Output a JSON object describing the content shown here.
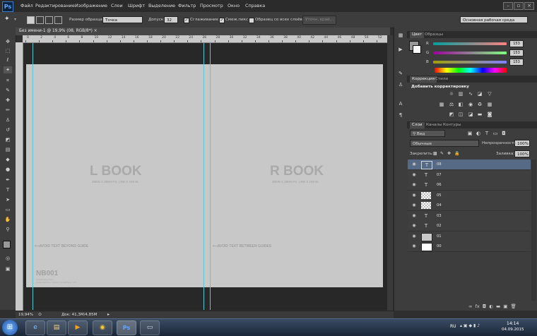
{
  "app": {
    "logo": "Ps"
  },
  "menu": [
    "Файл",
    "Редактирование",
    "Изображение",
    "Слои",
    "Шрифт",
    "Выделение",
    "Фильтр",
    "Просмотр",
    "Окно",
    "Справка"
  ],
  "options_bar": {
    "sample_size_label": "Размер образца:",
    "sample_size_value": "Точка",
    "tolerance_label": "Допуск:",
    "tolerance_value": "32",
    "antialias_label": "Сглаживание",
    "contiguous_label": "Смеж.пикс",
    "sample_all_label": "Образец со всех слоёв",
    "refine_button": "Уточн. край...",
    "workspace_value": "Основная рабочая среда"
  },
  "document": {
    "tab_title": "Без имени-1 @ 19,9% (08, RGB/8*) ×",
    "left_title": "L BOOK",
    "left_sub": "380W X 380H PX. | 8W X 100 M.",
    "right_title": "R BOOK",
    "right_sub": "380W X 380H PX. | 8W X 100 M.",
    "avoid_left": "AVOID TEXT BEYOND GUIDE",
    "avoid_right": "AVOID TEXT BETWEEN GUIDES",
    "code": "NB001",
    "code_lines": [
      "Something here",
      "Some details / Client / Something, Ltd."
    ]
  },
  "ruler_top": [
    "0",
    "2",
    "4",
    "6",
    "8",
    "10",
    "12",
    "14",
    "16",
    "18",
    "20",
    "22",
    "24",
    "26",
    "28",
    "30",
    "32",
    "34",
    "36",
    "38",
    "40",
    "42",
    "44",
    "46",
    "48",
    "50",
    "52"
  ],
  "status": {
    "zoom": "19,94%",
    "doc": "Док: 41,3M/4,85M"
  },
  "color_panel": {
    "tabs": [
      "Цвет",
      "Образцы"
    ],
    "channels": [
      {
        "label": "R",
        "value": "153"
      },
      {
        "label": "G",
        "value": "153"
      },
      {
        "label": "B",
        "value": "153"
      }
    ]
  },
  "adjust_panel": {
    "tabs": [
      "Коррекция",
      "Стили"
    ],
    "heading": "Добавить корректировку"
  },
  "layers_panel": {
    "tabs": [
      "Слои",
      "Каналы",
      "Контуры"
    ],
    "filter_value": "Вид",
    "blend_value": "Обычные",
    "opacity_label": "Непрозрачность:",
    "opacity_value": "100%",
    "lock_label": "Закрепить:",
    "fill_label": "Заливка:",
    "fill_value": "100%",
    "layers": [
      {
        "name": "08",
        "kind": "text",
        "selected": true
      },
      {
        "name": "07",
        "kind": "text",
        "selected": false
      },
      {
        "name": "06",
        "kind": "text",
        "selected": false
      },
      {
        "name": "05",
        "kind": "checker",
        "selected": false
      },
      {
        "name": "04",
        "kind": "checker",
        "selected": false
      },
      {
        "name": "03",
        "kind": "text",
        "selected": false
      },
      {
        "name": "02",
        "kind": "text",
        "selected": false
      },
      {
        "name": "01",
        "kind": "gray",
        "selected": false
      },
      {
        "name": "00",
        "kind": "white",
        "selected": false
      }
    ]
  },
  "taskbar": {
    "lang": "RU",
    "time": "14:14",
    "date": "04.09.2015"
  }
}
